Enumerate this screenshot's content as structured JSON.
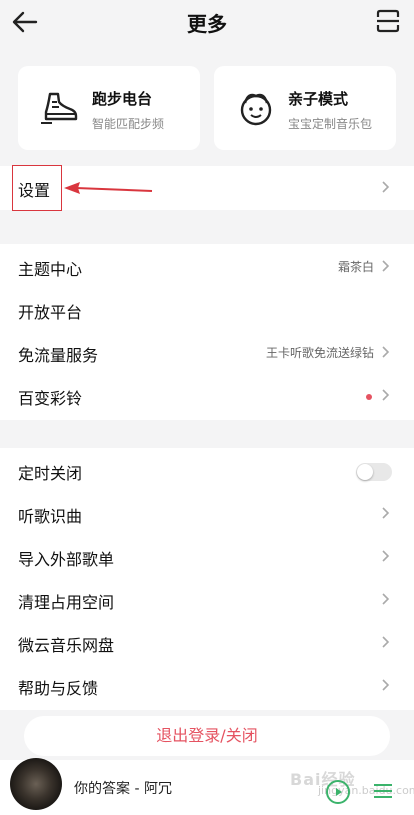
{
  "header": {
    "title": "更多"
  },
  "cards": [
    {
      "title": "跑步电台",
      "subtitle": "智能匹配步频",
      "icon": "running-shoe-icon"
    },
    {
      "title": "亲子模式",
      "subtitle": "宝宝定制音乐包",
      "icon": "baby-face-icon"
    }
  ],
  "settings": {
    "label": "设置"
  },
  "group1": [
    {
      "label": "主题中心",
      "value": "霜茶白"
    },
    {
      "label": "开放平台",
      "value": ""
    },
    {
      "label": "免流量服务",
      "value": "王卡听歌免流送绿钻"
    },
    {
      "label": "百变彩铃",
      "value": ""
    }
  ],
  "group2": [
    {
      "label": "定时关闭",
      "toggle": false
    },
    {
      "label": "听歌识曲"
    },
    {
      "label": "导入外部歌单"
    },
    {
      "label": "清理占用空间"
    },
    {
      "label": "微云音乐网盘"
    },
    {
      "label": "帮助与反馈"
    }
  ],
  "logout": {
    "label": "退出登录/关闭"
  },
  "player": {
    "song": "你的答案 - 阿冗"
  },
  "watermark": {
    "text": "Bai经验",
    "sub": "jingyan.baidu.com"
  },
  "colors": {
    "accent": "#e55361",
    "annotation": "#d9363e",
    "play": "#3bb36b"
  }
}
